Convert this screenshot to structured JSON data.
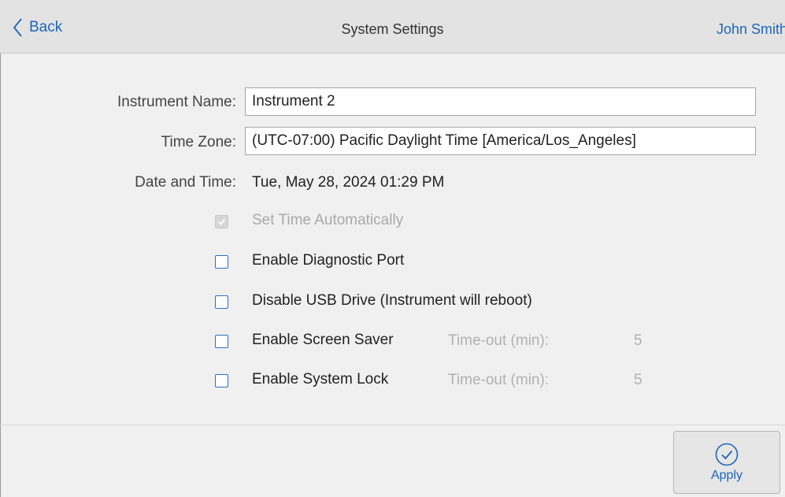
{
  "header": {
    "back_label": "Back",
    "title": "System Settings",
    "user": "John Smith"
  },
  "form": {
    "instrument_name_label": "Instrument Name:",
    "instrument_name_value": "Instrument 2",
    "time_zone_label": "Time Zone:",
    "time_zone_value": "(UTC-07:00) Pacific Daylight Time [America/Los_Angeles]",
    "date_time_label": "Date and Time:",
    "date_time_value": "Tue, May 28, 2024 01:29 PM"
  },
  "options": {
    "set_time_auto": {
      "label": "Set Time Automatically",
      "checked": true,
      "disabled": true
    },
    "diagnostic_port": {
      "label": "Enable Diagnostic Port",
      "checked": false
    },
    "disable_usb": {
      "label": "Disable USB Drive (Instrument will reboot)",
      "checked": false
    },
    "screen_saver": {
      "label": "Enable Screen Saver",
      "checked": false,
      "timeout_label": "Time-out (min):",
      "timeout_value": "5"
    },
    "system_lock": {
      "label": "Enable System Lock",
      "checked": false,
      "timeout_label": "Time-out (min):",
      "timeout_value": "5"
    }
  },
  "footer": {
    "apply_label": "Apply"
  },
  "icons": {
    "back": "chevron-left-icon",
    "apply": "check-circle-icon"
  },
  "colors": {
    "accent": "#1c66b8",
    "header_bg": "#e3e3e3",
    "page_bg": "#f0f0f0",
    "muted_text": "#b1b1b1"
  }
}
